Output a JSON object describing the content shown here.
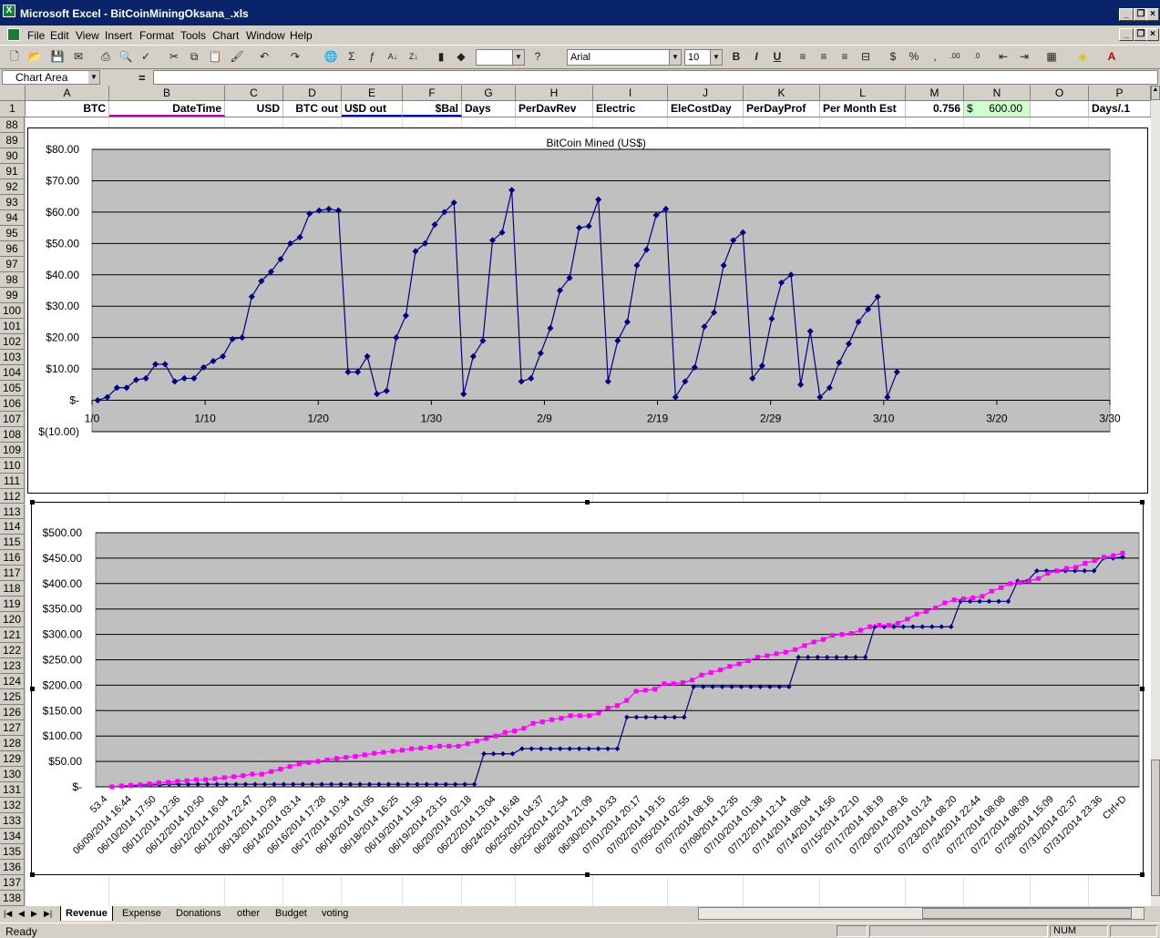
{
  "window": {
    "title": "Microsoft Excel - BitCoinMiningOksana_.xls"
  },
  "menu": [
    "File",
    "Edit",
    "View",
    "Insert",
    "Format",
    "Tools",
    "Chart",
    "Window",
    "Help"
  ],
  "toolbar": {
    "font": "Arial",
    "size": "10"
  },
  "namebox": "Chart Area",
  "fx": "=",
  "columns": [
    "A",
    "B",
    "C",
    "D",
    "E",
    "F",
    "G",
    "H",
    "I",
    "J",
    "K",
    "L",
    "M",
    "N",
    "O",
    "P"
  ],
  "row1": {
    "num": "1",
    "A": "BTC",
    "B": "DateTime",
    "C": "USD",
    "D": "BTC out",
    "E": "U$D out",
    "F": "$Bal",
    "G": "Days",
    "H": "PerDavRev",
    "I": "Electric",
    "J": "EleCostDay",
    "K": "PerDayProf",
    "L": "Per Month Est",
    "M": "0.756",
    "N_cur": "$",
    "N": "600.00",
    "P": "Days/.1"
  },
  "rows": [
    "88",
    "89",
    "90",
    "91",
    "92",
    "93",
    "94",
    "95",
    "96",
    "97",
    "98",
    "99",
    "100",
    "101",
    "102",
    "103",
    "104",
    "105",
    "106",
    "107",
    "108",
    "109",
    "110",
    "111",
    "112",
    "113",
    "114",
    "115",
    "116",
    "117",
    "118",
    "119",
    "120",
    "121",
    "122",
    "123",
    "124",
    "125",
    "126",
    "127",
    "128",
    "129",
    "130",
    "131",
    "132",
    "133",
    "134",
    "135",
    "136",
    "137",
    "138"
  ],
  "sheet_tabs": [
    "Revenue",
    "Expense",
    "Donations",
    "other",
    "Budget",
    "voting"
  ],
  "status": {
    "left": "Ready",
    "num": "NUM"
  },
  "colors": {
    "titlebar": "#0a246a",
    "plot_bg": "#c0c0c0",
    "series1": "#000080",
    "series2": "#ff00ff"
  },
  "chart_data": [
    {
      "type": "line",
      "title": "BitCoin Mined (US$)",
      "ylim": [
        -10,
        80
      ],
      "ytick_labels": [
        "$80.00",
        "$70.00",
        "$60.00",
        "$50.00",
        "$40.00",
        "$30.00",
        "$20.00",
        "$10.00",
        "$-",
        "$(10.00)"
      ],
      "xtick_labels": [
        "1/0",
        "1/10",
        "1/20",
        "1/30",
        "2/9",
        "2/19",
        "2/29",
        "3/10",
        "3/20",
        "3/30"
      ],
      "xlim": [
        0,
        90
      ],
      "x": [
        1,
        2,
        4,
        5,
        7,
        8,
        10,
        11,
        12,
        13,
        14,
        15,
        17,
        18,
        19,
        20,
        21,
        22,
        23,
        24,
        25,
        26,
        27,
        28,
        29,
        30,
        31,
        32,
        33,
        34,
        35,
        36,
        37,
        38,
        39,
        40,
        41,
        42,
        43,
        44,
        45,
        46,
        47,
        48,
        49,
        50,
        51,
        52,
        53,
        54,
        55,
        56,
        57,
        58,
        59,
        60,
        61,
        62,
        63,
        64,
        65,
        66,
        67,
        68,
        69,
        70,
        71,
        72,
        73,
        74,
        75,
        76,
        77,
        78,
        79,
        80,
        81,
        82,
        83,
        84,
        85,
        86,
        87,
        88,
        89,
        90,
        91,
        92,
        93,
        94,
        95,
        96,
        97,
        98,
        99,
        100,
        101,
        102,
        103,
        104,
        105,
        106
      ],
      "values": [
        0,
        1,
        4,
        4,
        6.5,
        7,
        11.5,
        11.5,
        6,
        7,
        7,
        10.5,
        12.5,
        14,
        19.5,
        20,
        33,
        38,
        41,
        45,
        50,
        52,
        59.5,
        60.5,
        61,
        60.5,
        9,
        9,
        14,
        2,
        3,
        20,
        27,
        47.5,
        50,
        56,
        60,
        63,
        2,
        14,
        19,
        51,
        53.5,
        67,
        6,
        7,
        15,
        23,
        35,
        39,
        55,
        55.5,
        64,
        6,
        19,
        25,
        43,
        48,
        59,
        61,
        1,
        6,
        10.5,
        23.5,
        28,
        43,
        51,
        53.5,
        7,
        11,
        26,
        37.5,
        40,
        5,
        22,
        1,
        4,
        12,
        18,
        25,
        29,
        33,
        1,
        9
      ],
      "x_mapped_note": "",
      "series": [
        {
          "values": []
        }
      ]
    },
    {
      "type": "line",
      "ylim": [
        0,
        500
      ],
      "ytick_labels": [
        "$500.00",
        "$450.00",
        "$400.00",
        "$350.00",
        "$300.00",
        "$250.00",
        "$200.00",
        "$150.00",
        "$100.00",
        "$50.00",
        "$-"
      ],
      "categories": [
        "53.4",
        "06/09/2014 16:44",
        "06/10/2014 17:50",
        "06/11/2014 12:36",
        "06/12/2014 10:50",
        "06/12/2014 16:04",
        "06/12/2014 22:47",
        "06/13/2014 10:29",
        "06/14/2014 03:14",
        "06/16/2014 17:28",
        "06/17/2014 10:34",
        "06/18/2014 01:05",
        "06/18/2014 16:25",
        "06/19/2014 11:50",
        "06/19/2014 23:15",
        "06/20/2014 02:18",
        "06/22/2014 13:04",
        "06/24/2014 16:48",
        "06/25/2014 04:37",
        "06/25/2014 12:54",
        "06/28/2014 21:09",
        "06/30/2014 10:33",
        "07/01/2014 20:17",
        "07/02/2014 19:15",
        "07/05/2014 02:55",
        "07/07/2014 08:16",
        "07/08/2014 12:35",
        "07/10/2014 01:38",
        "07/12/2014 12:14",
        "07/14/2014 08:04",
        "07/14/2014 14:56",
        "07/15/2014 22:10",
        "07/17/2014 18:19",
        "07/20/2014 09:16",
        "07/21/2014 01:24",
        "07/23/2014 08:20",
        "07/24/2014 22:44",
        "07/27/2014 08:08",
        "07/27/2014 08:09",
        "07/29/2014 15:09",
        "07/31/2014 02:37",
        "07/31/2014 23:36",
        "Ctrl+D"
      ],
      "series": [
        {
          "values": [
            0,
            1,
            2,
            3,
            4,
            4,
            5,
            5,
            5,
            5,
            5,
            5,
            5,
            5,
            5,
            5,
            5,
            5,
            5,
            5,
            5,
            5,
            5,
            5,
            5,
            5,
            5,
            5,
            5,
            5,
            5,
            5,
            5,
            5,
            5,
            5,
            5,
            5,
            5,
            65,
            65,
            65,
            65,
            75,
            75,
            75,
            75,
            75,
            75,
            75,
            75,
            75,
            75,
            75,
            137,
            137,
            137,
            137,
            137,
            137,
            137,
            197,
            197,
            197,
            197,
            197,
            197,
            197,
            197,
            197,
            197,
            197,
            255,
            255,
            255,
            255,
            255,
            255,
            255,
            255,
            315,
            315,
            315,
            315,
            315,
            315,
            315,
            315,
            315,
            365,
            365,
            365,
            365,
            365,
            365,
            405,
            405,
            425,
            425,
            425,
            425,
            425,
            425,
            425,
            450,
            450,
            452
          ]
        },
        {
          "values": [
            0,
            2,
            3,
            4,
            6,
            8,
            9,
            11,
            12,
            14,
            14,
            16,
            18,
            20,
            22,
            25,
            25,
            30,
            35,
            40,
            45,
            48,
            50,
            53,
            56,
            58,
            60,
            63,
            66,
            68,
            70,
            72,
            75,
            76,
            78,
            80,
            80,
            80,
            85,
            90,
            95,
            100,
            107,
            110,
            115,
            125,
            128,
            132,
            135,
            140,
            140,
            140,
            145,
            155,
            160,
            170,
            188,
            190,
            192,
            203,
            203,
            205,
            210,
            220,
            225,
            230,
            237,
            242,
            248,
            255,
            258,
            262,
            265,
            270,
            278,
            285,
            290,
            298,
            300,
            302,
            308,
            315,
            318,
            318,
            322,
            330,
            340,
            345,
            352,
            362,
            368,
            370,
            372,
            375,
            385,
            392,
            400,
            402,
            405,
            410,
            420,
            425,
            430,
            432,
            440,
            445,
            452,
            455,
            460
          ]
        }
      ]
    }
  ]
}
